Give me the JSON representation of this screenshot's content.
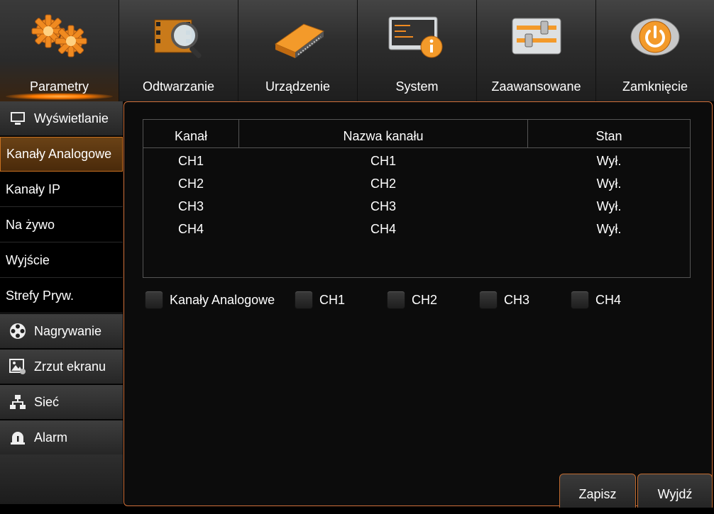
{
  "tabs": [
    {
      "label": "Parametry",
      "icon": "gears-icon",
      "active": true
    },
    {
      "label": "Odtwarzanie",
      "icon": "film-search-icon",
      "active": false
    },
    {
      "label": "Urządzenie",
      "icon": "hard-drive-icon",
      "active": false
    },
    {
      "label": "System",
      "icon": "system-info-icon",
      "active": false
    },
    {
      "label": "Zaawansowane",
      "icon": "sliders-icon",
      "active": false
    },
    {
      "label": "Zamknięcie",
      "icon": "power-icon",
      "active": false
    }
  ],
  "nav": {
    "items": [
      {
        "label": "Wyświetlanie",
        "type": "category",
        "icon": "monitor-icon"
      },
      {
        "label": "Kanały Analogowe",
        "type": "sub",
        "selected": true
      },
      {
        "label": "Kanały IP",
        "type": "sub"
      },
      {
        "label": "Na żywo",
        "type": "sub"
      },
      {
        "label": "Wyjście",
        "type": "sub"
      },
      {
        "label": "Strefy Pryw.",
        "type": "sub"
      },
      {
        "label": "Nagrywanie",
        "type": "category",
        "icon": "film-reel-icon"
      },
      {
        "label": "Zrzut ekranu",
        "type": "category",
        "icon": "snapshot-icon"
      },
      {
        "label": "Sieć",
        "type": "category",
        "icon": "network-icon"
      },
      {
        "label": "Alarm",
        "type": "category",
        "icon": "alarm-icon"
      }
    ]
  },
  "table": {
    "headers": {
      "channel": "Kanał",
      "name": "Nazwa kanału",
      "status": "Stan"
    },
    "rows": [
      {
        "channel": "CH1",
        "name": "CH1",
        "status": "Wył."
      },
      {
        "channel": "CH2",
        "name": "CH2",
        "status": "Wył."
      },
      {
        "channel": "CH3",
        "name": "CH3",
        "status": "Wył."
      },
      {
        "channel": "CH4",
        "name": "CH4",
        "status": "Wył."
      }
    ]
  },
  "checkboxes": {
    "all_label": "Kanały Analogowe",
    "ch1": "CH1",
    "ch2": "CH2",
    "ch3": "CH3",
    "ch4": "CH4"
  },
  "buttons": {
    "save": "Zapisz",
    "exit": "Wyjdź"
  },
  "colors": {
    "accent": "#d0703a",
    "selected": "#5a3612"
  }
}
